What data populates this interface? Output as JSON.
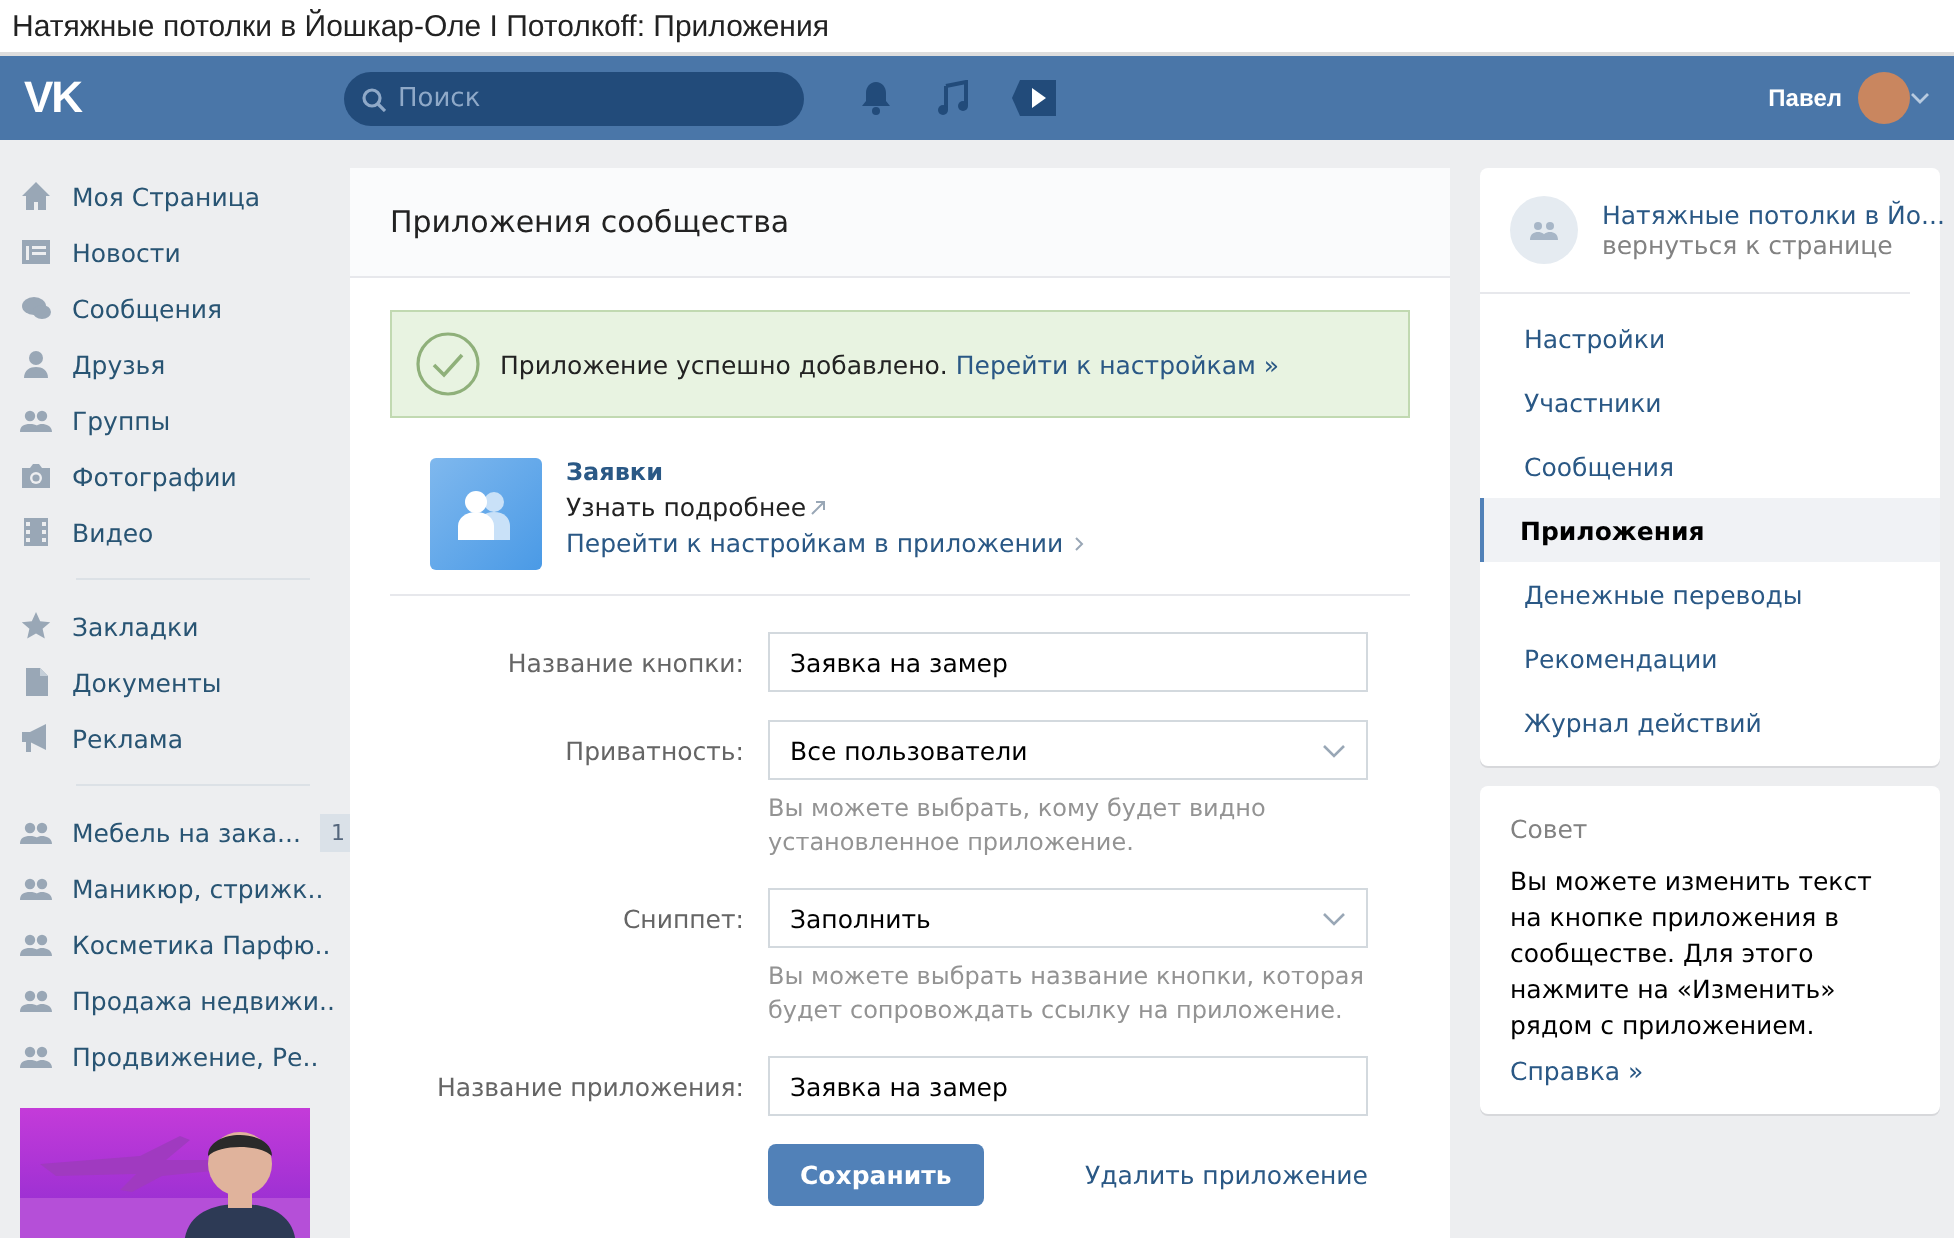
{
  "window": {
    "title": "Натяжные потолки в Йошкар-Оле I Потолкoff: Приложения"
  },
  "header": {
    "logo": "VK",
    "search": {
      "placeholder": "Поиск"
    },
    "user": "Павел"
  },
  "sidebar": {
    "sections": [
      [
        {
          "label": "Моя Страница"
        },
        {
          "label": "Новости"
        },
        {
          "label": "Сообщения"
        },
        {
          "label": "Друзья"
        },
        {
          "label": "Группы"
        },
        {
          "label": "Фотографии"
        },
        {
          "label": "Видео"
        }
      ],
      [
        {
          "label": "Закладки"
        },
        {
          "label": "Документы"
        },
        {
          "label": "Реклама"
        }
      ],
      [
        {
          "label": "Мебель на зака...",
          "counter": "1"
        },
        {
          "label": "Маникюр, стрижк.."
        },
        {
          "label": "Косметика Парфю.."
        },
        {
          "label": "Продажа недвижи.."
        },
        {
          "label": "Продвижение, Ре.."
        }
      ]
    ],
    "ad": {
      "kind": "picture"
    }
  },
  "main": {
    "title": "Приложения сообщества",
    "notice": {
      "text": "Приложение успешно добавлено.",
      "link": "Перейти к настройкам »"
    },
    "app": {
      "name": "Заявки",
      "more": "Узнать подробнее",
      "settings": "Перейти к настройкам в приложении"
    },
    "form": [
      {
        "kind": "input",
        "label": "Название кнопки:",
        "value": "Заявка на замер"
      },
      {
        "kind": "select",
        "label": "Приватность:",
        "value": "Все пользователи",
        "hint": "Вы можете выбрать, кому будет видно установленное приложение."
      },
      {
        "kind": "select",
        "label": "Сниппет:",
        "value": "Заполнить",
        "hint": "Вы можете выбрать название кнопки, которая будет сопровождать ссылку на приложение."
      },
      {
        "kind": "input",
        "label": "Название приложения:",
        "value": "Заявка на замер"
      }
    ],
    "save": "Сохранить",
    "delete": "Удалить приложение"
  },
  "community": {
    "name": "Натяжные потолки в Йо...",
    "back": "вернуться к странице",
    "menu": [
      {
        "label": "Настройки",
        "selected": false
      },
      {
        "label": "Участники",
        "selected": false
      },
      {
        "label": "Сообщения",
        "selected": false
      },
      {
        "label": "Приложения",
        "selected": true
      },
      {
        "label": "Денежные переводы",
        "selected": false
      },
      {
        "label": "Рекомендации",
        "selected": false
      },
      {
        "label": "Журнал действий",
        "selected": false
      }
    ]
  },
  "tip": {
    "title": "Совет",
    "text": "Вы можете изменить текст на кнопке приложения в сообществе. Для этого нажмите на «Изменить» рядом с приложением.",
    "link": "Справка »"
  }
}
